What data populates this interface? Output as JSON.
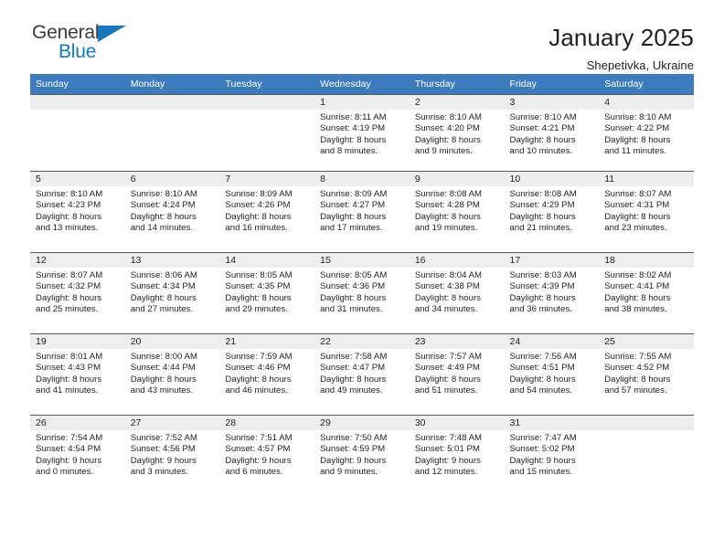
{
  "brand": {
    "name_part1": "General",
    "name_part2": "Blue",
    "accent_color": "#1878be",
    "triangle_icon": "brand-triangle-icon"
  },
  "header": {
    "title": "January 2025",
    "subtitle": "Shepetivka, Ukraine"
  },
  "calendar": {
    "header_color": "#3c7cbe",
    "weekday_headers": [
      "Sunday",
      "Monday",
      "Tuesday",
      "Wednesday",
      "Thursday",
      "Friday",
      "Saturday"
    ],
    "weeks": [
      {
        "days": [
          {
            "number": "",
            "lines": []
          },
          {
            "number": "",
            "lines": []
          },
          {
            "number": "",
            "lines": []
          },
          {
            "number": "1",
            "lines": [
              "Sunrise: 8:11 AM",
              "Sunset: 4:19 PM",
              "Daylight: 8 hours",
              "and 8 minutes."
            ]
          },
          {
            "number": "2",
            "lines": [
              "Sunrise: 8:10 AM",
              "Sunset: 4:20 PM",
              "Daylight: 8 hours",
              "and 9 minutes."
            ]
          },
          {
            "number": "3",
            "lines": [
              "Sunrise: 8:10 AM",
              "Sunset: 4:21 PM",
              "Daylight: 8 hours",
              "and 10 minutes."
            ]
          },
          {
            "number": "4",
            "lines": [
              "Sunrise: 8:10 AM",
              "Sunset: 4:22 PM",
              "Daylight: 8 hours",
              "and 11 minutes."
            ]
          }
        ]
      },
      {
        "days": [
          {
            "number": "5",
            "lines": [
              "Sunrise: 8:10 AM",
              "Sunset: 4:23 PM",
              "Daylight: 8 hours",
              "and 13 minutes."
            ]
          },
          {
            "number": "6",
            "lines": [
              "Sunrise: 8:10 AM",
              "Sunset: 4:24 PM",
              "Daylight: 8 hours",
              "and 14 minutes."
            ]
          },
          {
            "number": "7",
            "lines": [
              "Sunrise: 8:09 AM",
              "Sunset: 4:26 PM",
              "Daylight: 8 hours",
              "and 16 minutes."
            ]
          },
          {
            "number": "8",
            "lines": [
              "Sunrise: 8:09 AM",
              "Sunset: 4:27 PM",
              "Daylight: 8 hours",
              "and 17 minutes."
            ]
          },
          {
            "number": "9",
            "lines": [
              "Sunrise: 8:08 AM",
              "Sunset: 4:28 PM",
              "Daylight: 8 hours",
              "and 19 minutes."
            ]
          },
          {
            "number": "10",
            "lines": [
              "Sunrise: 8:08 AM",
              "Sunset: 4:29 PM",
              "Daylight: 8 hours",
              "and 21 minutes."
            ]
          },
          {
            "number": "11",
            "lines": [
              "Sunrise: 8:07 AM",
              "Sunset: 4:31 PM",
              "Daylight: 8 hours",
              "and 23 minutes."
            ]
          }
        ]
      },
      {
        "days": [
          {
            "number": "12",
            "lines": [
              "Sunrise: 8:07 AM",
              "Sunset: 4:32 PM",
              "Daylight: 8 hours",
              "and 25 minutes."
            ]
          },
          {
            "number": "13",
            "lines": [
              "Sunrise: 8:06 AM",
              "Sunset: 4:34 PM",
              "Daylight: 8 hours",
              "and 27 minutes."
            ]
          },
          {
            "number": "14",
            "lines": [
              "Sunrise: 8:05 AM",
              "Sunset: 4:35 PM",
              "Daylight: 8 hours",
              "and 29 minutes."
            ]
          },
          {
            "number": "15",
            "lines": [
              "Sunrise: 8:05 AM",
              "Sunset: 4:36 PM",
              "Daylight: 8 hours",
              "and 31 minutes."
            ]
          },
          {
            "number": "16",
            "lines": [
              "Sunrise: 8:04 AM",
              "Sunset: 4:38 PM",
              "Daylight: 8 hours",
              "and 34 minutes."
            ]
          },
          {
            "number": "17",
            "lines": [
              "Sunrise: 8:03 AM",
              "Sunset: 4:39 PM",
              "Daylight: 8 hours",
              "and 36 minutes."
            ]
          },
          {
            "number": "18",
            "lines": [
              "Sunrise: 8:02 AM",
              "Sunset: 4:41 PM",
              "Daylight: 8 hours",
              "and 38 minutes."
            ]
          }
        ]
      },
      {
        "days": [
          {
            "number": "19",
            "lines": [
              "Sunrise: 8:01 AM",
              "Sunset: 4:43 PM",
              "Daylight: 8 hours",
              "and 41 minutes."
            ]
          },
          {
            "number": "20",
            "lines": [
              "Sunrise: 8:00 AM",
              "Sunset: 4:44 PM",
              "Daylight: 8 hours",
              "and 43 minutes."
            ]
          },
          {
            "number": "21",
            "lines": [
              "Sunrise: 7:59 AM",
              "Sunset: 4:46 PM",
              "Daylight: 8 hours",
              "and 46 minutes."
            ]
          },
          {
            "number": "22",
            "lines": [
              "Sunrise: 7:58 AM",
              "Sunset: 4:47 PM",
              "Daylight: 8 hours",
              "and 49 minutes."
            ]
          },
          {
            "number": "23",
            "lines": [
              "Sunrise: 7:57 AM",
              "Sunset: 4:49 PM",
              "Daylight: 8 hours",
              "and 51 minutes."
            ]
          },
          {
            "number": "24",
            "lines": [
              "Sunrise: 7:56 AM",
              "Sunset: 4:51 PM",
              "Daylight: 8 hours",
              "and 54 minutes."
            ]
          },
          {
            "number": "25",
            "lines": [
              "Sunrise: 7:55 AM",
              "Sunset: 4:52 PM",
              "Daylight: 8 hours",
              "and 57 minutes."
            ]
          }
        ]
      },
      {
        "days": [
          {
            "number": "26",
            "lines": [
              "Sunrise: 7:54 AM",
              "Sunset: 4:54 PM",
              "Daylight: 9 hours",
              "and 0 minutes."
            ]
          },
          {
            "number": "27",
            "lines": [
              "Sunrise: 7:52 AM",
              "Sunset: 4:56 PM",
              "Daylight: 9 hours",
              "and 3 minutes."
            ]
          },
          {
            "number": "28",
            "lines": [
              "Sunrise: 7:51 AM",
              "Sunset: 4:57 PM",
              "Daylight: 9 hours",
              "and 6 minutes."
            ]
          },
          {
            "number": "29",
            "lines": [
              "Sunrise: 7:50 AM",
              "Sunset: 4:59 PM",
              "Daylight: 9 hours",
              "and 9 minutes."
            ]
          },
          {
            "number": "30",
            "lines": [
              "Sunrise: 7:48 AM",
              "Sunset: 5:01 PM",
              "Daylight: 9 hours",
              "and 12 minutes."
            ]
          },
          {
            "number": "31",
            "lines": [
              "Sunrise: 7:47 AM",
              "Sunset: 5:02 PM",
              "Daylight: 9 hours",
              "and 15 minutes."
            ]
          },
          {
            "number": "",
            "lines": []
          }
        ]
      }
    ]
  }
}
